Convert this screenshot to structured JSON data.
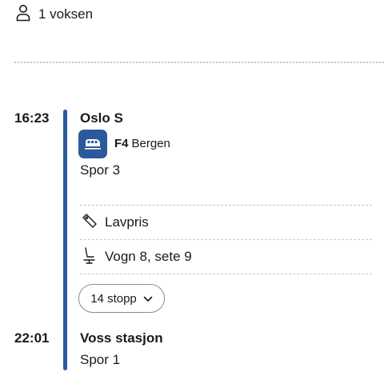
{
  "passengers": {
    "label": "1 voksen",
    "icon": "person-icon"
  },
  "departure": {
    "time": "16:23",
    "station": "Oslo S",
    "track": "Spor 3"
  },
  "train": {
    "line_code": "F4",
    "destination": "Bergen",
    "icon": "train-icon",
    "color": "#2a5a9b"
  },
  "details": [
    {
      "label": "Lavpris",
      "icon": "ticket-icon"
    },
    {
      "label": "Vogn 8, sete 9",
      "icon": "seat-icon"
    }
  ],
  "stops_button": {
    "label": "14 stopp",
    "icon": "chevron-down-icon"
  },
  "arrival": {
    "time": "22:01",
    "station": "Voss stasjon",
    "track": "Spor 1"
  },
  "colors": {
    "timeline": "#2a5a9b",
    "text": "#1a1a1a"
  }
}
